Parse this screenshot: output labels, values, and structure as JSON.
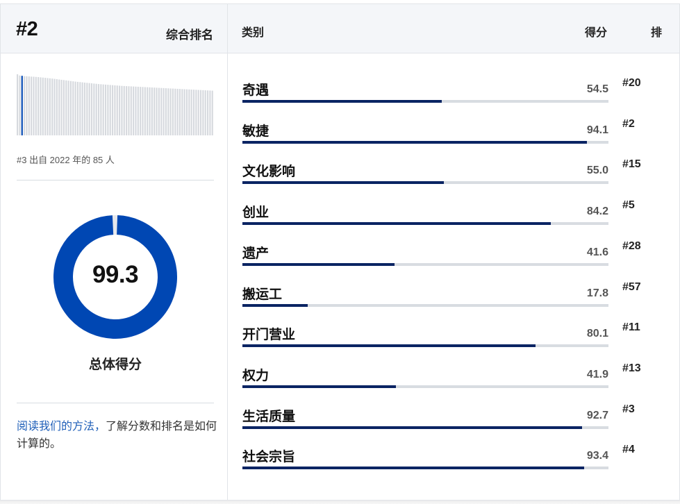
{
  "summary": {
    "rank": "#2",
    "rank_label": "综合排名",
    "spark_values": [
      100,
      98,
      97.5,
      97,
      96.8,
      96.5,
      96.2,
      96,
      95.7,
      95.4,
      95,
      94.6,
      94.2,
      93.8,
      93.4,
      93,
      92.5,
      92,
      91.5,
      91,
      90.5,
      90,
      89.5,
      89,
      88.5,
      88,
      87.6,
      87.2,
      86.8,
      86.4,
      86,
      85.6,
      85.2,
      84.8,
      84.4,
      84,
      83.7,
      83.4,
      83.1,
      82.8,
      82.5,
      82.2,
      81.9,
      81.6,
      81.3,
      81,
      80.8,
      80.6,
      80.4,
      80.2,
      80,
      79.8,
      79.6,
      79.4,
      79.2,
      79,
      78.8,
      78.6,
      78.4,
      78.2,
      78,
      77.8,
      77.6,
      77.4,
      77.2,
      77,
      76.8,
      76.6,
      76.4,
      76.2,
      76,
      75.8,
      75.6,
      75.4,
      75.2,
      75,
      74.8,
      74.6,
      74.4,
      74.2,
      74,
      73.8,
      73.6,
      73.4,
      73.2
    ],
    "spark_highlight_index": 2,
    "spark_caption": "#3 出自 2022 年的 85 人",
    "overall_score": "99.3",
    "overall_score_fraction": 0.993,
    "overall_label": "总体得分",
    "method_link": "阅读我们的方法，",
    "method_text": "了解分数和排名是如何计算的。",
    "colors": {
      "accent": "#0047b3",
      "bar": "#0a2463",
      "track": "#d8dce1",
      "link": "#1f5fb8"
    }
  },
  "table": {
    "col_category": "类别",
    "col_score": "得分",
    "col_rank": "排",
    "rows": [
      {
        "category": "奇遇",
        "score": "54.5",
        "rank": "#20",
        "fraction": 0.545
      },
      {
        "category": "敏捷",
        "score": "94.1",
        "rank": "#2",
        "fraction": 0.941
      },
      {
        "category": "文化影响",
        "score": "55.0",
        "rank": "#15",
        "fraction": 0.55
      },
      {
        "category": "创业",
        "score": "84.2",
        "rank": "#5",
        "fraction": 0.842
      },
      {
        "category": "遗产",
        "score": "41.6",
        "rank": "#28",
        "fraction": 0.416
      },
      {
        "category": "搬运工",
        "score": "17.8",
        "rank": "#57",
        "fraction": 0.178
      },
      {
        "category": "开门营业",
        "score": "80.1",
        "rank": "#11",
        "fraction": 0.801
      },
      {
        "category": "权力",
        "score": "41.9",
        "rank": "#13",
        "fraction": 0.419
      },
      {
        "category": "生活质量",
        "score": "92.7",
        "rank": "#3",
        "fraction": 0.927
      },
      {
        "category": "社会宗旨",
        "score": "93.4",
        "rank": "#4",
        "fraction": 0.934
      }
    ]
  }
}
